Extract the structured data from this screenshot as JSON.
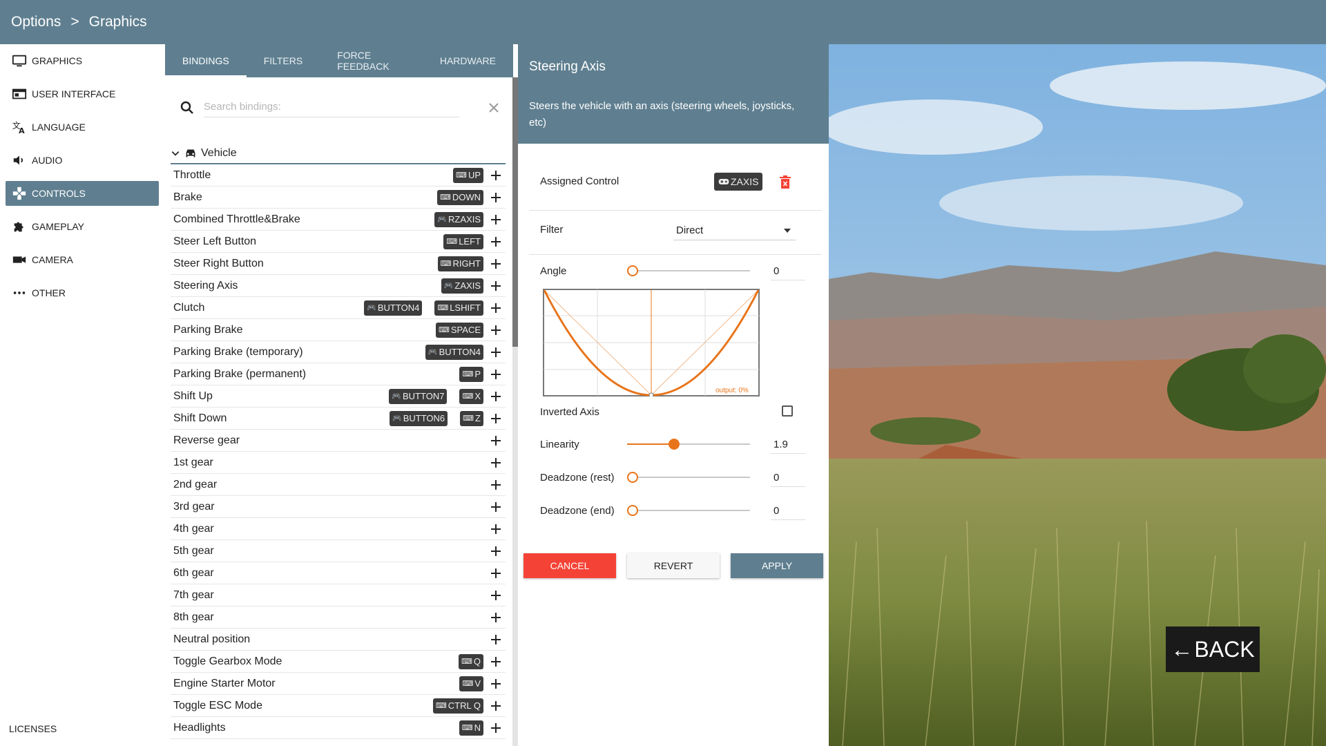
{
  "header": {
    "crumb1": "Options",
    "separator": ">",
    "crumb2": "Graphics"
  },
  "sidebar": {
    "items": [
      {
        "label": "GRAPHICS",
        "icon": "monitor-icon"
      },
      {
        "label": "USER INTERFACE",
        "icon": "window-icon"
      },
      {
        "label": "LANGUAGE",
        "icon": "translate-icon"
      },
      {
        "label": "AUDIO",
        "icon": "speaker-icon"
      },
      {
        "label": "CONTROLS",
        "icon": "gamepad-icon",
        "active": true
      },
      {
        "label": "GAMEPLAY",
        "icon": "puzzle-icon"
      },
      {
        "label": "CAMERA",
        "icon": "videocam-icon"
      },
      {
        "label": "OTHER",
        "icon": "more-dots-icon"
      }
    ],
    "licenses": "LICENSES"
  },
  "tabs": [
    {
      "label": "BINDINGS",
      "active": true
    },
    {
      "label": "FILTERS"
    },
    {
      "label": "FORCE FEEDBACK"
    },
    {
      "label": "HARDWARE"
    }
  ],
  "search": {
    "placeholder": "Search bindings:",
    "value": ""
  },
  "category": {
    "label": "Vehicle"
  },
  "bindings": [
    {
      "label": "Throttle",
      "keys": [
        {
          "t": "kbd",
          "v": "UP"
        }
      ]
    },
    {
      "label": "Brake",
      "keys": [
        {
          "t": "kbd",
          "v": "DOWN"
        }
      ]
    },
    {
      "label": "Combined Throttle&Brake",
      "keys": [
        {
          "t": "pad",
          "v": "RZAXIS"
        }
      ]
    },
    {
      "label": "Steer Left Button",
      "keys": [
        {
          "t": "kbd",
          "v": "LEFT"
        }
      ]
    },
    {
      "label": "Steer Right Button",
      "keys": [
        {
          "t": "kbd",
          "v": "RIGHT"
        }
      ]
    },
    {
      "label": "Steering Axis",
      "keys": [
        {
          "t": "pad",
          "v": "ZAXIS"
        }
      ]
    },
    {
      "label": "Clutch",
      "keys": [
        {
          "t": "pad",
          "v": "BUTTON4"
        },
        {
          "t": "kbd",
          "v": "LSHIFT"
        }
      ]
    },
    {
      "label": "Parking Brake",
      "keys": [
        {
          "t": "kbd",
          "v": "SPACE"
        }
      ]
    },
    {
      "label": "Parking Brake (temporary)",
      "keys": [
        {
          "t": "pad",
          "v": "BUTTON4"
        }
      ]
    },
    {
      "label": "Parking Brake (permanent)",
      "keys": [
        {
          "t": "kbd",
          "v": "P"
        }
      ]
    },
    {
      "label": "Shift Up",
      "keys": [
        {
          "t": "pad",
          "v": "BUTTON7"
        },
        {
          "t": "kbd",
          "v": "X"
        }
      ]
    },
    {
      "label": "Shift Down",
      "keys": [
        {
          "t": "pad",
          "v": "BUTTON6"
        },
        {
          "t": "kbd",
          "v": "Z"
        }
      ]
    },
    {
      "label": "Reverse gear",
      "keys": []
    },
    {
      "label": "1st gear",
      "keys": []
    },
    {
      "label": "2nd gear",
      "keys": []
    },
    {
      "label": "3rd gear",
      "keys": []
    },
    {
      "label": "4th gear",
      "keys": []
    },
    {
      "label": "5th gear",
      "keys": []
    },
    {
      "label": "6th gear",
      "keys": []
    },
    {
      "label": "7th gear",
      "keys": []
    },
    {
      "label": "8th gear",
      "keys": []
    },
    {
      "label": "Neutral position",
      "keys": []
    },
    {
      "label": "Toggle Gearbox Mode",
      "keys": [
        {
          "t": "kbd",
          "v": "Q"
        }
      ]
    },
    {
      "label": "Engine Starter Motor",
      "keys": [
        {
          "t": "kbd",
          "v": "V"
        }
      ]
    },
    {
      "label": "Toggle ESC Mode",
      "keys": [
        {
          "t": "kbd",
          "v": "CTRL Q"
        }
      ]
    },
    {
      "label": "Headlights",
      "keys": [
        {
          "t": "kbd",
          "v": "N"
        }
      ]
    }
  ],
  "detail": {
    "title": "Steering Axis",
    "description": "Steers the vehicle with an axis (steering wheels, joysticks, etc)",
    "assigned_label": "Assigned Control",
    "assigned_value": "ZAXIS",
    "filter_label": "Filter",
    "filter_value": "Direct",
    "angle_label": "Angle",
    "angle_value": "0",
    "angle_fraction": 0,
    "curve_output": "output: 0%",
    "inverted_label": "Inverted Axis",
    "inverted_checked": false,
    "linearity_label": "Linearity",
    "linearity_value": "1.9",
    "linearity_fraction": 0.37,
    "deadzone_rest_label": "Deadzone (rest)",
    "deadzone_rest_value": "0",
    "deadzone_rest_fraction": 0,
    "deadzone_end_label": "Deadzone (end)",
    "deadzone_end_value": "0",
    "deadzone_end_fraction": 0,
    "cancel_label": "CANCEL",
    "revert_label": "REVERT",
    "apply_label": "APPLY"
  },
  "back_label": "BACK",
  "colors": {
    "accent": "#5f7f90",
    "orange": "#e8741a",
    "danger": "#f44336"
  }
}
